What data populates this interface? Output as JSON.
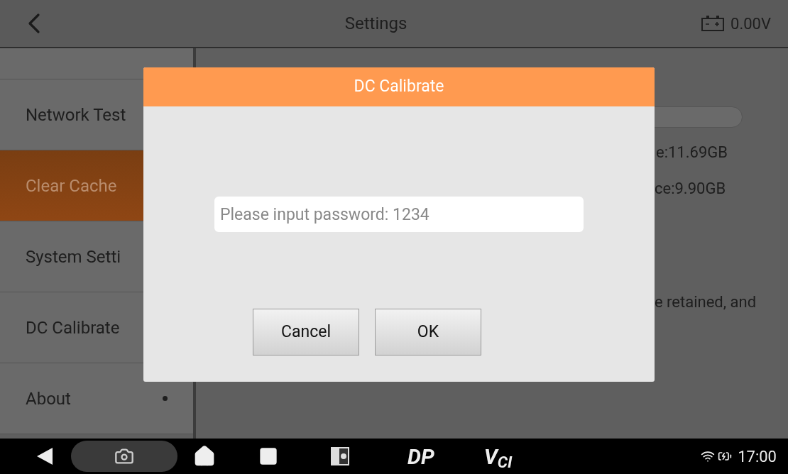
{
  "top_bar": {
    "title": "Settings",
    "voltage": "0.00V"
  },
  "sidebar": {
    "items": [
      {
        "selected": false,
        "dot": false
      },
      {
        "label": "Network Test",
        "selected": false,
        "dot": false
      },
      {
        "label": "Clear Cache",
        "selected": true,
        "dot": false
      },
      {
        "label": "System Setti",
        "selected": false,
        "dot": false
      },
      {
        "label": "DC Calibrate",
        "selected": false,
        "dot": false
      },
      {
        "label": "About",
        "selected": false,
        "dot": true
      }
    ]
  },
  "panel": {
    "lines": [
      "e:11.69GB",
      "ce:9.90GB",
      "e retained, and"
    ]
  },
  "dialog": {
    "title": "DC Calibrate",
    "field": {
      "placeholder": "Please input password: 1234"
    },
    "buttons": [
      "Cancel",
      "OK"
    ]
  },
  "nav_bar": {
    "logos": [
      "DP",
      "V$_{CI}$"
    ],
    "time": "17:00"
  }
}
